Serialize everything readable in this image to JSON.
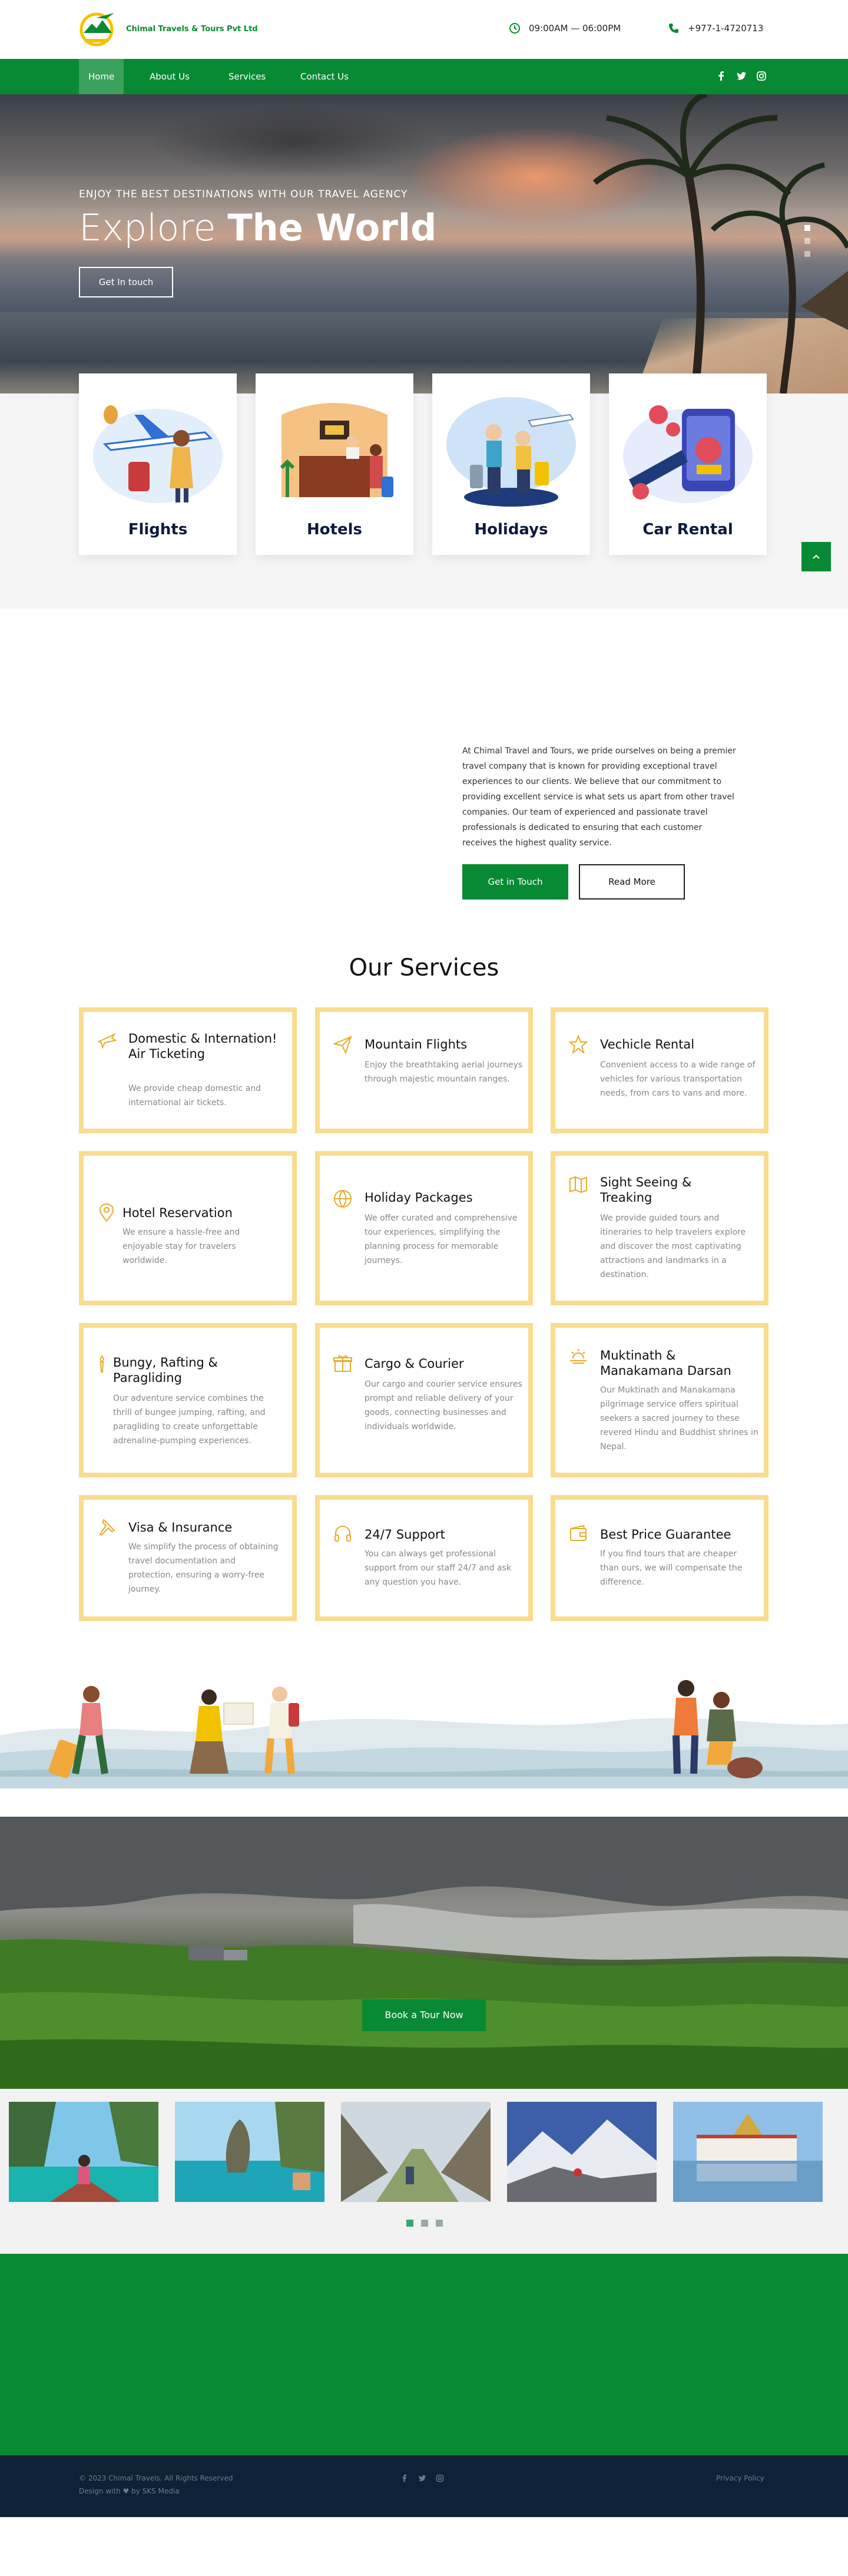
{
  "header": {
    "brand": "Chimal Travels & Tours Pvt Ltd",
    "hours": "09:00AM — 06:00PM",
    "phone": "+977-1-4720713"
  },
  "nav": {
    "items": [
      "Home",
      "About Us",
      "Services",
      "Contact Us"
    ],
    "active": "Home",
    "social_icons": [
      "facebook-icon",
      "twitter-icon",
      "instagram-icon"
    ]
  },
  "hero": {
    "subtitle": "ENJOY THE BEST DESTINATIONS WITH OUR TRAVEL AGENCY",
    "title_light": "Explore ",
    "title_bold": "The World",
    "button": "Get In touch"
  },
  "features": [
    "Flights",
    "Hotels",
    "Holidays",
    "Car Rental"
  ],
  "about": {
    "text": "At Chimal Travel and Tours, we pride ourselves on being a premier travel company that is known for providing exceptional travel experiences to our clients. We believe that our commitment to providing excellent service is what sets us apart from other travel companies. Our team of experienced and passionate travel professionals is dedicated to ensuring that each customer receives the highest quality service.",
    "primary_button": "Get in Touch",
    "secondary_button": "Read More"
  },
  "services": {
    "title": "Our Services",
    "items": [
      {
        "title": "Domestic & Internation! Air Ticketing",
        "desc": "We provide cheap domestic and international air tickets.",
        "icon": "airplane-icon"
      },
      {
        "title": "Mountain Flights",
        "desc": "Enjoy the breathtaking aerial journeys through majestic mountain ranges.",
        "icon": "paper-plane-icon"
      },
      {
        "title": "Vechicle Rental",
        "desc": "Convenient access to a wide range of vehicles for various transportation needs, from cars to vans and more.",
        "icon": "star-icon"
      },
      {
        "title": "Hotel Reservation",
        "desc": "We ensure a hassle-free and enjoyable stay for travelers worldwide.",
        "icon": "location-pin-icon"
      },
      {
        "title": "Holiday Packages",
        "desc": "We offer curated and comprehensive tour experiences, simplifying the planning process for memorable journeys.",
        "icon": "globe-icon"
      },
      {
        "title": "Sight Seeing & Treaking",
        "desc": "We provide guided tours and itineraries to help travelers explore and discover the most captivating attractions and landmarks in a destination.",
        "icon": "map-icon"
      },
      {
        "title": "Bungy, Rafting & Paragliding",
        "desc": "Our adventure service combines the thrill of bungee jumping, rafting, and paragliding to create unforgettable adrenaline-pumping experiences.",
        "icon": "torch-icon"
      },
      {
        "title": "Cargo & Courier",
        "desc": "Our cargo and courier service ensures prompt and reliable delivery of your goods, connecting businesses and individuals worldwide.",
        "icon": "gift-box-icon"
      },
      {
        "title": "Muktinath & Manakamana Darsan",
        "desc": "Our Muktinath and Manakamana pilgrimage service offers spiritual seekers a sacred journey to these revered Hindu and Buddhist shrines in Nepal.",
        "icon": "sunrise-icon"
      },
      {
        "title": "Visa & Insurance",
        "desc": "We simplify the process of obtaining travel documentation and protection, ensuring a worry-free journey.",
        "icon": "pin-icon"
      },
      {
        "title": "24/7 Support",
        "desc": "You can always get professional support from our staff 24/7 and ask any question you have.",
        "icon": "headphones-icon"
      },
      {
        "title": "Best Price Guarantee",
        "desc": "If you find tours that are cheaper than ours, we will compensate the difference.",
        "icon": "wallet-icon"
      }
    ]
  },
  "tour": {
    "button": "Book a Tour Now"
  },
  "gallery": {
    "dots_total": 3,
    "dots_active": 1
  },
  "footer": {
    "copyright": "© 2023 Chimal Travels. All Rights Reserved",
    "credit": "Design with ♥ by SKS Media",
    "privacy": "Privacy Policy"
  },
  "colors": {
    "brand_green": "#088a34",
    "accent_yellow": "#f9dc8f",
    "footer_navy": "#0e2136"
  }
}
